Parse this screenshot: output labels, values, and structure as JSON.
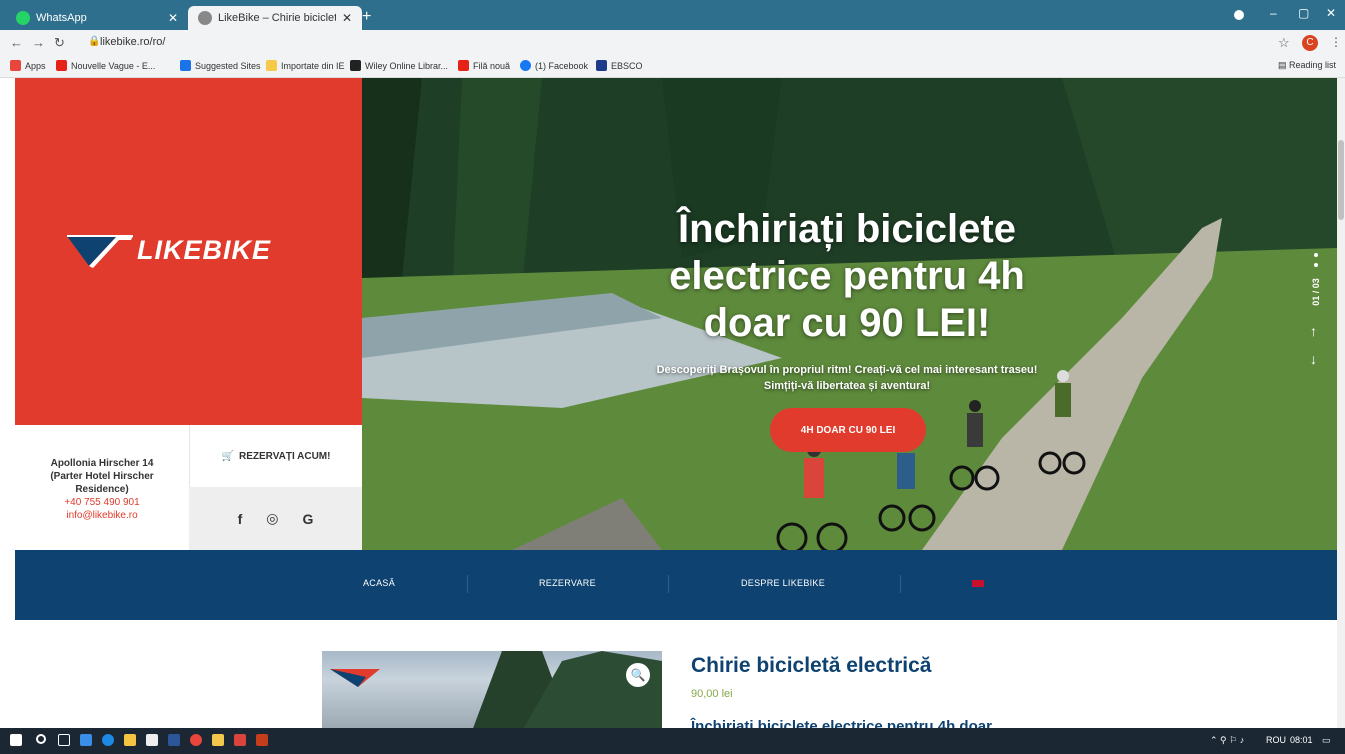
{
  "browser": {
    "tabs": [
      {
        "label": "WhatsApp",
        "icon": "whatsapp-icon",
        "color": "#25d366"
      },
      {
        "label": "LikeBike – Chirie bicicletă electric",
        "icon": "globe-icon",
        "color": "#555555"
      }
    ],
    "new_tab": "+",
    "window_controls": {
      "minimize": "–",
      "restore": "▢",
      "close": "✕"
    },
    "url": "likebike.ro/ro/",
    "bookmarks": [
      {
        "label": "Apps",
        "color": "#e8453c"
      },
      {
        "label": "Nouvelle Vague - E...",
        "color": "#e62117"
      },
      {
        "label": "Suggested Sites",
        "color": "#1a73e8"
      },
      {
        "label": "Importate din IE",
        "color": "#f7c948"
      },
      {
        "label": "Wiley Online Librar...",
        "color": "#222222"
      },
      {
        "label": "Filă nouă",
        "color": "#e62117"
      },
      {
        "label": "(1) Facebook",
        "color": "#1877f2"
      },
      {
        "label": "EBSCO",
        "color": "#1e3a8a"
      }
    ],
    "reading_list": "Reading list",
    "profile_initial": "C"
  },
  "site": {
    "logo": "LIKEBIKE",
    "address_lines": [
      "Apollonia Hirscher 14",
      "(Parter Hotel Hirscher",
      "Residence)"
    ],
    "phone": "+40 755 490 901",
    "email": "info@likebike.ro",
    "reserve_label": "REZERVAȚI ACUM!",
    "socials": [
      "f",
      "◎",
      "G"
    ],
    "hero": {
      "title": "Închiriați biciclete electrice pentru 4h doar cu 90 LEI!",
      "subtitle_1": "Descoperiți Brașovul în propriul ritm! Creați-vă cel mai interesant traseu!",
      "subtitle_2": "Simțiți-vă libertatea și aventura!",
      "button": "4H DOAR CU 90 LEI",
      "slide_counter": "01 / 03"
    },
    "nav": [
      "ACASĂ",
      "REZERVARE",
      "DESPRE LIKEBIKE"
    ],
    "product": {
      "title": "Chirie bicicletă electrică",
      "price": "90,00 lei",
      "desc": "Închiriați biciclete electrice pentru 4h doar"
    }
  },
  "taskbar": {
    "tray_lang": "ROU",
    "time": "08:01"
  },
  "colors": {
    "brand_red": "#e03b2c",
    "nav_blue": "#0e4270",
    "price_green": "#86a84a"
  }
}
